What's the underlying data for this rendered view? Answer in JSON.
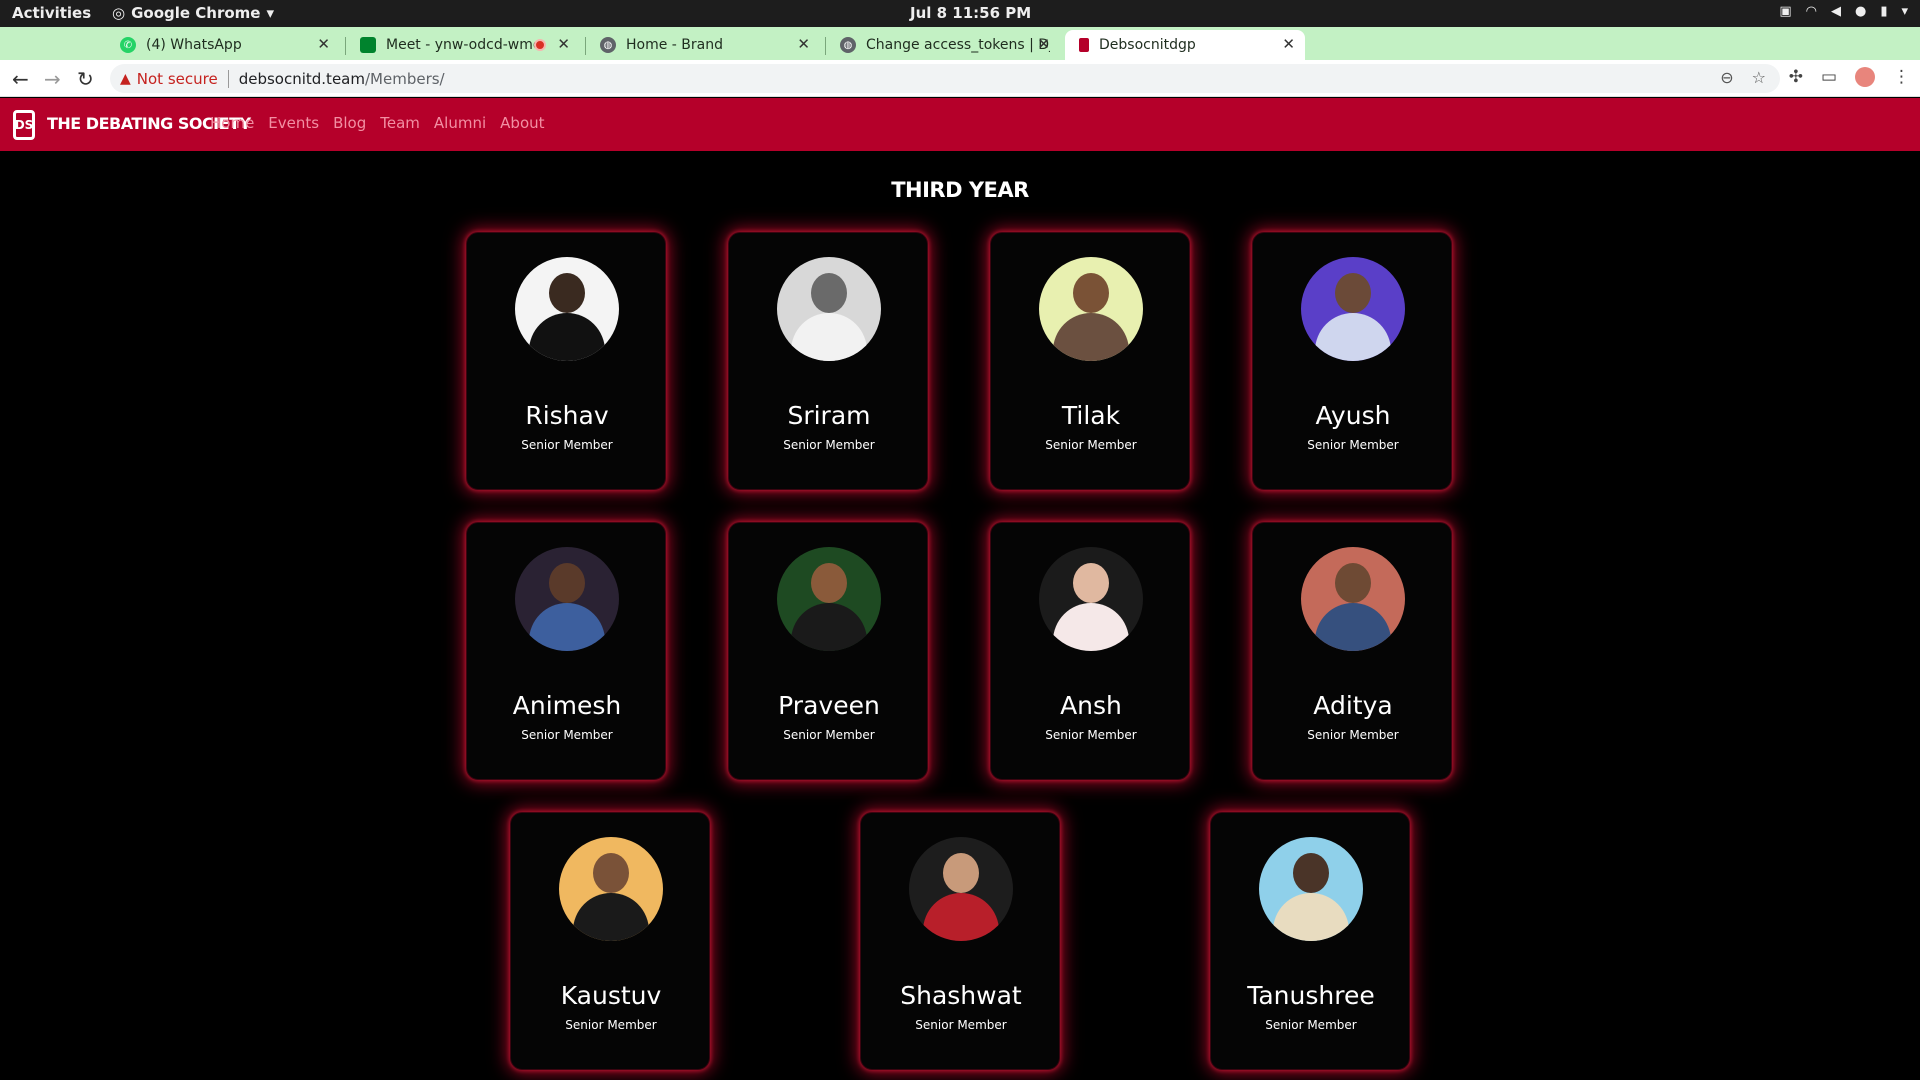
{
  "system": {
    "activities": "Activities",
    "app_name": "Google Chrome",
    "clock": "Jul 8  11:56 PM"
  },
  "tabs": [
    {
      "title": "(4) WhatsApp",
      "icon": "whatsapp-icon",
      "color": "#25d366"
    },
    {
      "title": "Meet - ynw-odcd-wme",
      "icon": "meet-icon",
      "color": "#00832d"
    },
    {
      "title": "Home - Brand",
      "icon": "globe-icon",
      "color": "#5f6368"
    },
    {
      "title": "Change access_tokens | Djan",
      "icon": "globe-icon",
      "color": "#5f6368"
    },
    {
      "title": "Debsocnitdgp",
      "icon": "site-icon",
      "color": "#b5002a"
    }
  ],
  "address_bar": {
    "security_label": "Not secure",
    "host": "debsocnitd.team",
    "path": "/Members/"
  },
  "site": {
    "brand": "THE DEBATING SOCIETY",
    "logo_text": "DS",
    "nav": [
      "Home",
      "Events",
      "Blog",
      "Team",
      "Alumni",
      "About"
    ],
    "accent": "#b5002a"
  },
  "section": {
    "title": "THIRD YEAR",
    "members": [
      {
        "name": "Rishav",
        "role": "Senior Member",
        "bg": "#f4f4f4",
        "head": "#3a2a20",
        "body": "#111111"
      },
      {
        "name": "Sriram",
        "role": "Senior Member",
        "bg": "#d8d8d8",
        "head": "#6a6a6a",
        "body": "#f2f2f2"
      },
      {
        "name": "Tilak",
        "role": "Senior Member",
        "bg": "#e8f0b0",
        "head": "#7a5236",
        "body": "#6b5040"
      },
      {
        "name": "Ayush",
        "role": "Senior Member",
        "bg": "#5a3fc8",
        "head": "#6b4a38",
        "body": "#cfd6ee"
      },
      {
        "name": "Animesh",
        "role": "Senior Member",
        "bg": "#2a2233",
        "head": "#5a3a2a",
        "body": "#3d5f9e"
      },
      {
        "name": "Praveen",
        "role": "Senior Member",
        "bg": "#1e4a22",
        "head": "#8a5a3a",
        "body": "#1a1a1a"
      },
      {
        "name": "Ansh",
        "role": "Senior Member",
        "bg": "#1b1b1b",
        "head": "#e0b8a0",
        "body": "#f5e8e8"
      },
      {
        "name": "Aditya",
        "role": "Senior Member",
        "bg": "#c46a5a",
        "head": "#6e4a34",
        "body": "#36507e"
      },
      {
        "name": "Kaustuv",
        "role": "Senior Member",
        "bg": "#f0b860",
        "head": "#7a5238",
        "body": "#1a1a1a"
      },
      {
        "name": "Shashwat",
        "role": "Senior Member",
        "bg": "#1d1d1d",
        "head": "#c89a7a",
        "body": "#b81f2a"
      },
      {
        "name": "Tanushree",
        "role": "Senior Member",
        "bg": "#8fd0ea",
        "head": "#4a3428",
        "body": "#e8dcc0"
      }
    ]
  }
}
